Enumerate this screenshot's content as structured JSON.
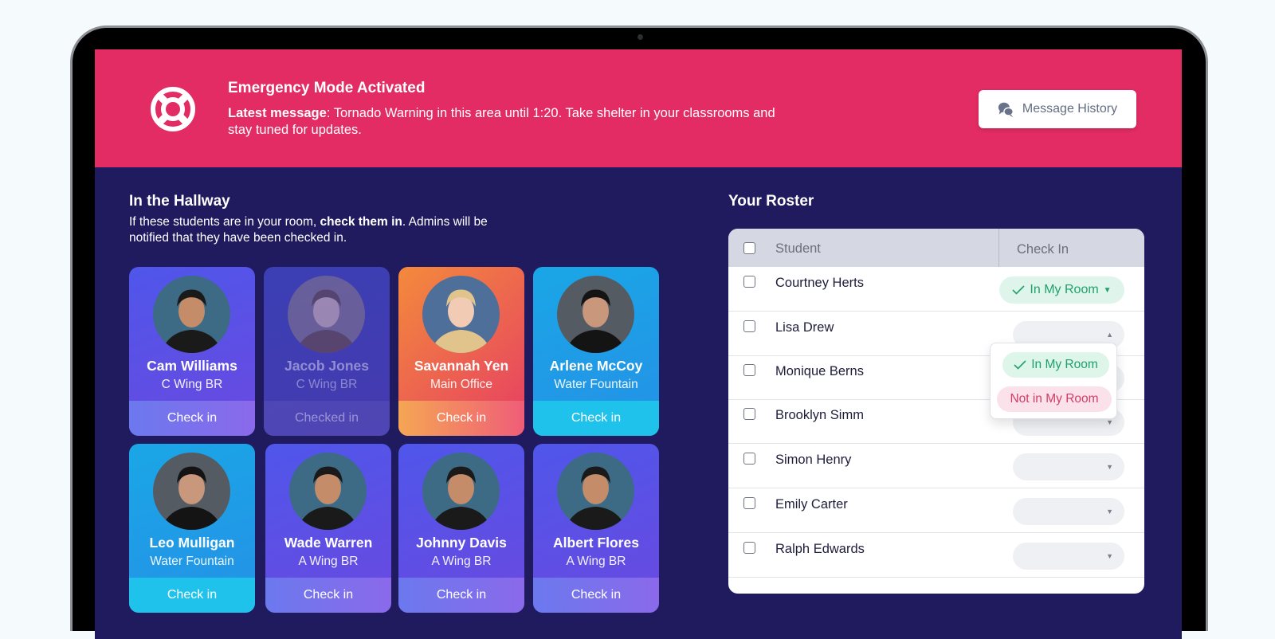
{
  "banner": {
    "icon": "lifebuoy-icon",
    "title": "Emergency Mode Activated",
    "message_label": "Latest message",
    "message_text": ": Tornado Warning in this area until 1:20. Take shelter in your classrooms and stay tuned for updates.",
    "history_button": "Message History",
    "history_icon": "chat-bubbles-icon",
    "color": "#e22c63"
  },
  "hallway": {
    "title": "In the Hallway",
    "desc_pre": "If these students are in your room, ",
    "desc_bold": "check them in",
    "desc_post": ". Admins will be notified that they have been checked in.",
    "students": [
      {
        "name": "Cam Williams",
        "location": "C Wing BR",
        "action": "Check in",
        "status": "pending",
        "theme": "purple"
      },
      {
        "name": "Jacob Jones",
        "location": "C Wing BR",
        "action": "Checked in",
        "status": "checked",
        "theme": "purple-dim"
      },
      {
        "name": "Savannah Yen",
        "location": "Main Office",
        "action": "Check in",
        "status": "pending",
        "theme": "orange"
      },
      {
        "name": "Arlene McCoy",
        "location": "Water Fountain",
        "action": "Check in",
        "status": "pending",
        "theme": "cyan"
      },
      {
        "name": "Leo Mulligan",
        "location": "Water Fountain",
        "action": "Check in",
        "status": "pending",
        "theme": "cyan"
      },
      {
        "name": "Wade Warren",
        "location": "A Wing BR",
        "action": "Check in",
        "status": "pending",
        "theme": "purple"
      },
      {
        "name": "Johnny Davis",
        "location": "A Wing BR",
        "action": "Check in",
        "status": "pending",
        "theme": "purple"
      },
      {
        "name": "Albert Flores",
        "location": "A Wing BR",
        "action": "Check in",
        "status": "pending",
        "theme": "purple"
      }
    ]
  },
  "roster": {
    "title": "Your Roster",
    "columns": {
      "student": "Student",
      "check_in": "Check In"
    },
    "rows": [
      {
        "name": "Courtney Herts",
        "status": "In My Room"
      },
      {
        "name": "Lisa Drew",
        "status": ""
      },
      {
        "name": "Monique Berns",
        "status": ""
      },
      {
        "name": "Brooklyn Simm",
        "status": ""
      },
      {
        "name": "Simon Henry",
        "status": ""
      },
      {
        "name": "Emily Carter",
        "status": ""
      },
      {
        "name": "Ralph Edwards",
        "status": ""
      }
    ],
    "dropdown": {
      "open_for": "Lisa Drew",
      "options": [
        "In My Room",
        "Not in My Room"
      ]
    },
    "colors": {
      "in_room": "#20a06b",
      "not_in_room": "#d23c66"
    }
  }
}
